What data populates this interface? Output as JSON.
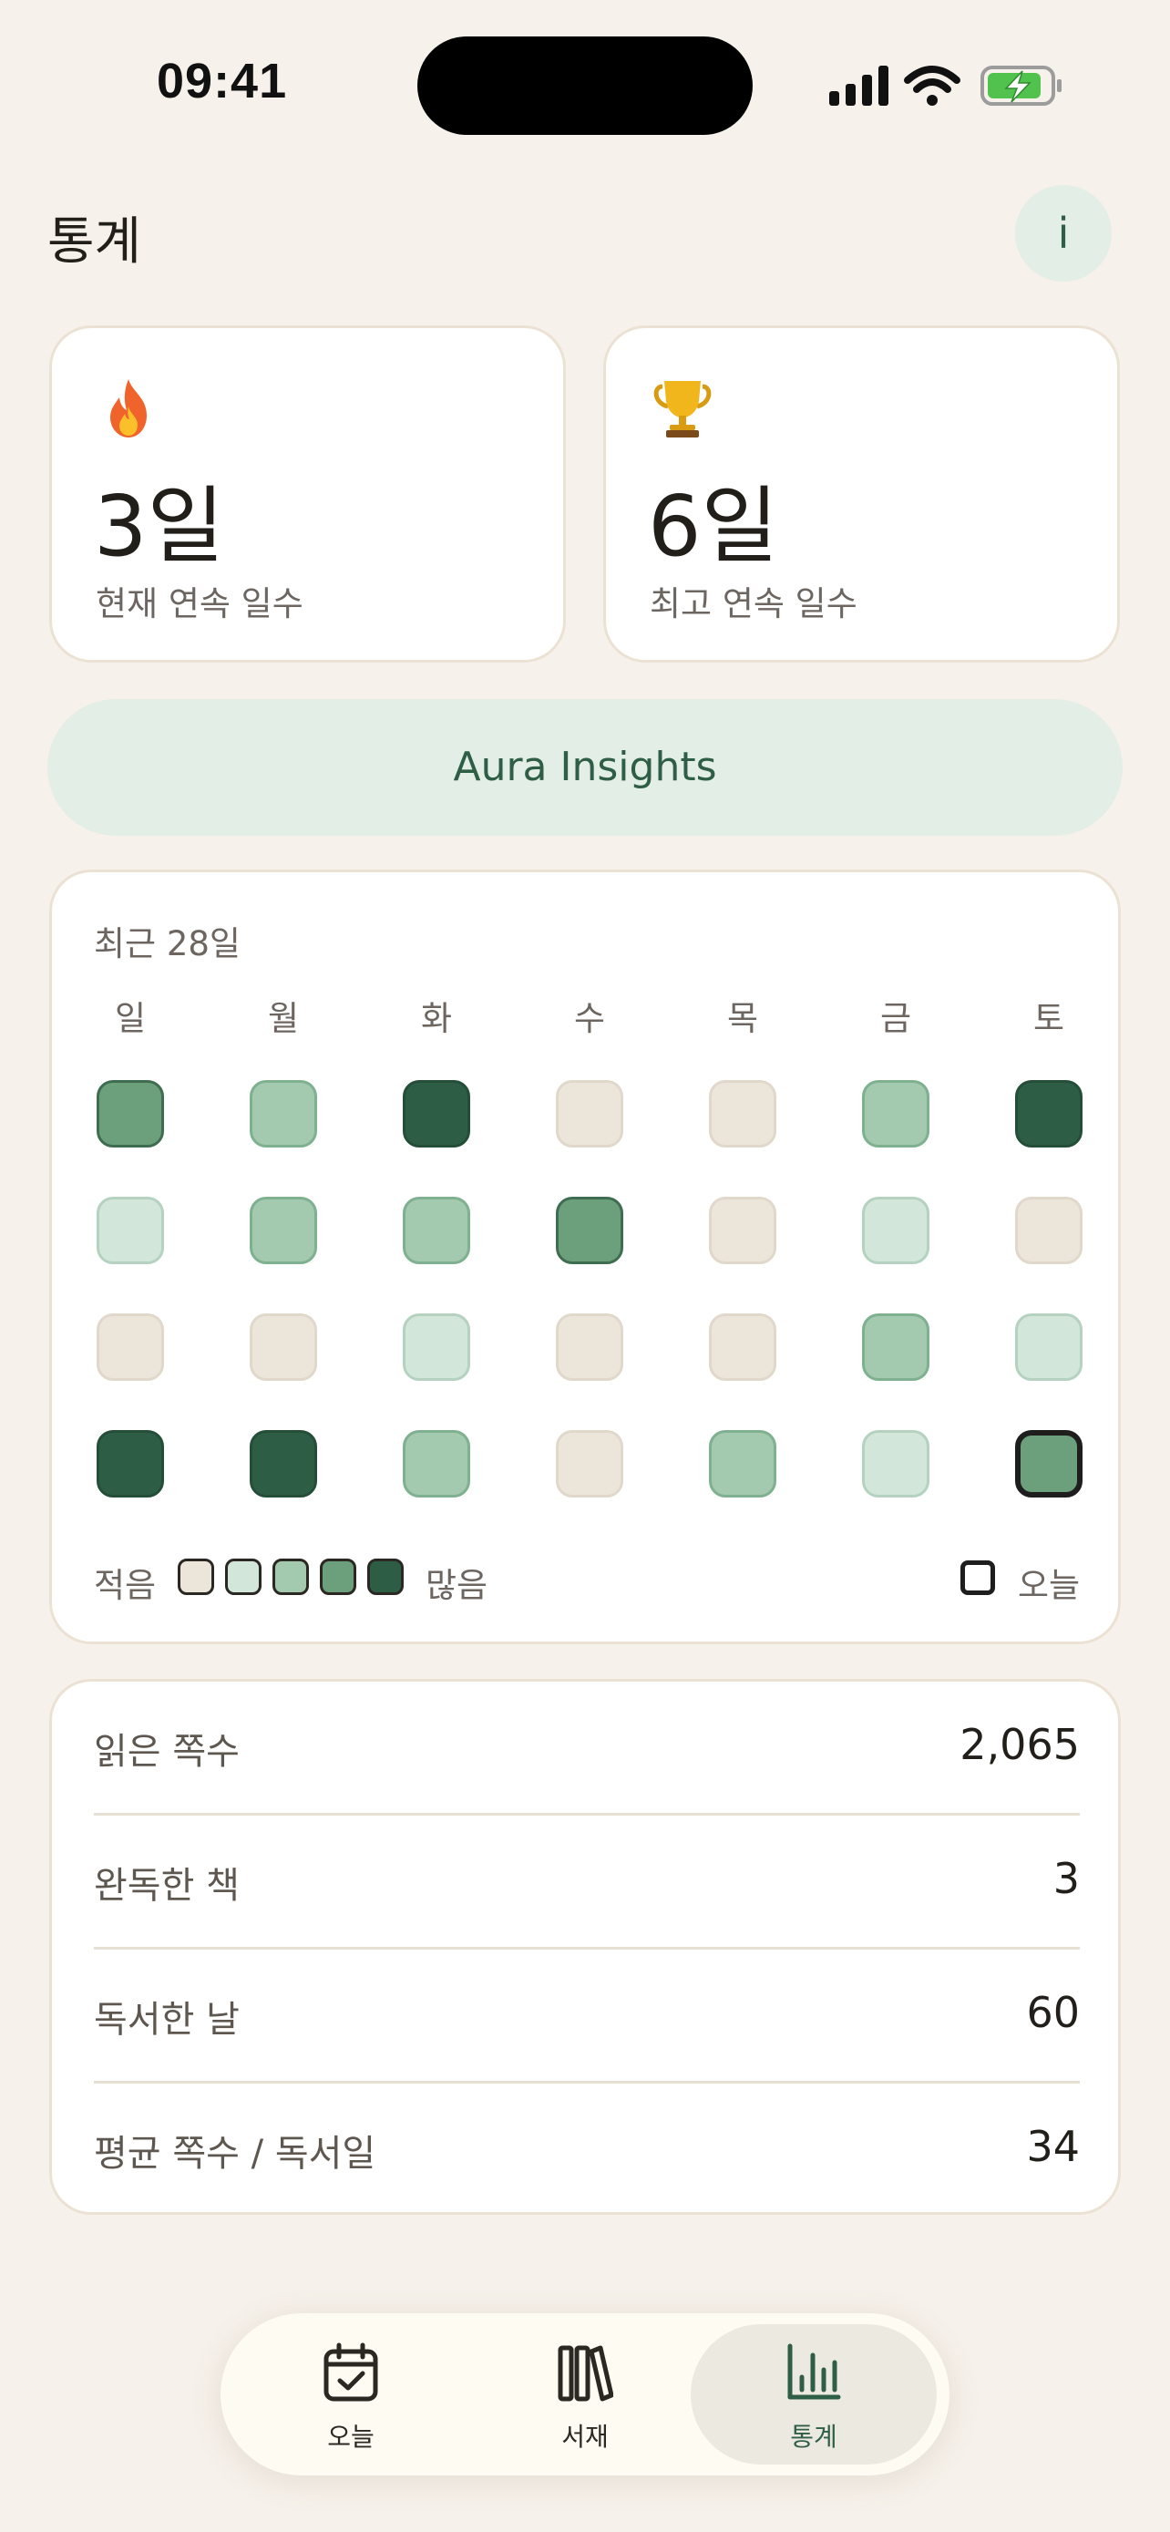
{
  "status_bar": {
    "time": "09:41"
  },
  "header": {
    "title": "통계",
    "info_label": "i"
  },
  "streaks": {
    "current": {
      "icon": "fire-icon",
      "value": "3일",
      "label": "현재 연속 일수"
    },
    "best": {
      "icon": "trophy-icon",
      "value": "6일",
      "label": "최고 연속 일수"
    }
  },
  "insights": {
    "label": "Aura Insights"
  },
  "calendar": {
    "title": "최근 28일",
    "weekdays": [
      "일",
      "월",
      "화",
      "수",
      "목",
      "금",
      "토"
    ],
    "levels": [
      [
        3,
        2,
        4,
        0,
        0,
        2,
        4
      ],
      [
        1,
        2,
        2,
        3,
        0,
        1,
        0
      ],
      [
        0,
        0,
        1,
        0,
        0,
        2,
        1
      ],
      [
        4,
        4,
        2,
        0,
        2,
        1,
        3
      ]
    ],
    "today_index": 27,
    "legend": {
      "less": "적음",
      "more": "많음",
      "today": "오늘"
    }
  },
  "colors": {
    "accent": "#2f5e46",
    "level0": "#ece5da",
    "level1": "#d3e6da",
    "level2": "#a3c9ae",
    "level3": "#6c9f7c",
    "level4": "#2d5e45"
  },
  "stats": [
    {
      "label": "읽은 쪽수",
      "value": "2,065"
    },
    {
      "label": "완독한 책",
      "value": "3"
    },
    {
      "label": "독서한 날",
      "value": "60"
    },
    {
      "label": "평균 쪽수 / 독서일",
      "value": "34"
    }
  ],
  "nav": [
    {
      "label": "오늘",
      "icon": "calendar-check-icon",
      "active": false
    },
    {
      "label": "서재",
      "icon": "books-icon",
      "active": false
    },
    {
      "label": "통계",
      "icon": "bar-chart-icon",
      "active": true
    }
  ]
}
